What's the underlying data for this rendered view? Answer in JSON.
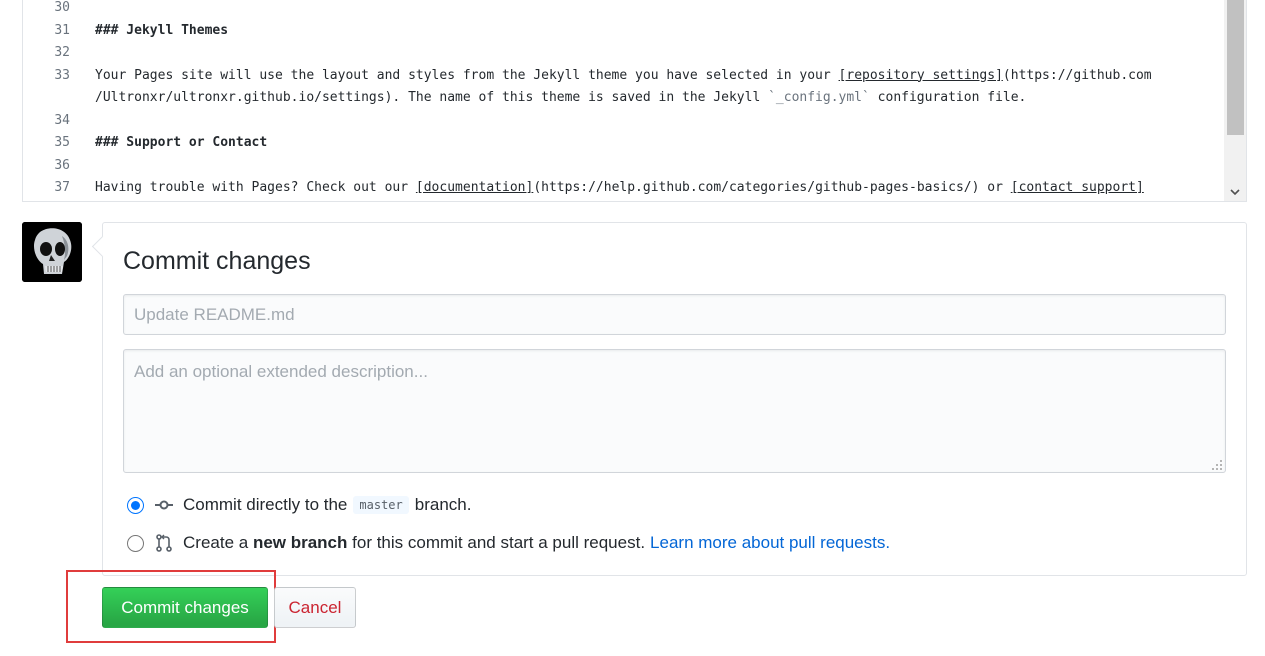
{
  "editor": {
    "lines": [
      {
        "num": "30",
        "segments": []
      },
      {
        "num": "31",
        "segments": [
          {
            "text": "### Jekyll Themes",
            "style": "bold"
          }
        ]
      },
      {
        "num": "32",
        "segments": []
      },
      {
        "num": "33",
        "segments": [
          {
            "text": "Your Pages site will use the layout and styles from the Jekyll theme you have selected in your ",
            "style": ""
          },
          {
            "text": "[repository settings]",
            "style": "ul"
          },
          {
            "text": "(https://github.com",
            "style": ""
          }
        ]
      },
      {
        "num": "",
        "segments": [
          {
            "text": "/Ultronxr/ultronxr.github.io/settings). The name of this theme is saved in the Jekyll ",
            "style": ""
          },
          {
            "text": "`_config.yml`",
            "style": "inline-code"
          },
          {
            "text": " configuration file.",
            "style": ""
          }
        ]
      },
      {
        "num": "34",
        "segments": []
      },
      {
        "num": "35",
        "segments": [
          {
            "text": "### Support or Contact",
            "style": "bold"
          }
        ]
      },
      {
        "num": "36",
        "segments": []
      },
      {
        "num": "37",
        "segments": [
          {
            "text": "Having trouble with Pages? Check out our ",
            "style": ""
          },
          {
            "text": "[documentation]",
            "style": "ul"
          },
          {
            "text": "(https://help.github.com/categories/github-pages-basics/) or ",
            "style": ""
          },
          {
            "text": "[contact support]",
            "style": "ul"
          }
        ]
      }
    ]
  },
  "commit": {
    "title": "Commit changes",
    "summary_placeholder": "Update README.md",
    "description_placeholder": "Add an optional extended description...",
    "option_direct": {
      "prefix": "Commit directly to the",
      "branch": "master",
      "suffix": "branch.",
      "selected": true
    },
    "option_new_branch": {
      "prefix": "Create a",
      "bold": "new branch",
      "suffix": "for this commit and start a pull request.",
      "link": "Learn more about pull requests.",
      "selected": false
    }
  },
  "buttons": {
    "commit_label": "Commit changes",
    "cancel_label": "Cancel"
  },
  "colors": {
    "primary_button": "#28a745",
    "cancel_text": "#cb2431",
    "link": "#0366d6",
    "highlight_frame": "#e03c3c"
  },
  "icons": {
    "commit": "git-commit-icon",
    "pull_request": "git-pull-request-icon",
    "scroll_down": "chevron-down-icon"
  }
}
